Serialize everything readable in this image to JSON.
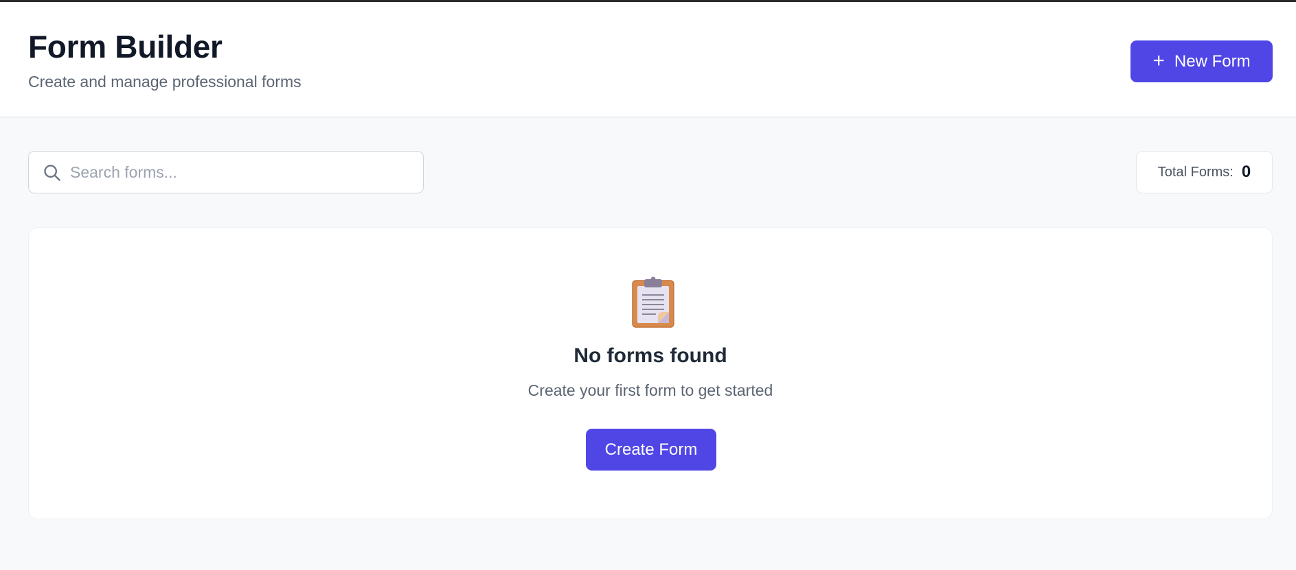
{
  "header": {
    "title": "Form Builder",
    "subtitle": "Create and manage professional forms",
    "new_button_label": "New Form",
    "new_button_icon": "plus-icon"
  },
  "toolbar": {
    "search_placeholder": "Search forms...",
    "search_value": "",
    "search_icon": "search-icon",
    "total_label": "Total Forms:",
    "total_value": "0"
  },
  "empty_state": {
    "icon": "clipboard-icon",
    "title": "No forms found",
    "message": "Create your first form to get started",
    "button_label": "Create Form"
  },
  "colors": {
    "accent": "#4f46e5",
    "background": "#f8f9fb",
    "surface": "#ffffff",
    "text_primary": "#111827",
    "text_secondary": "#5b6472"
  }
}
